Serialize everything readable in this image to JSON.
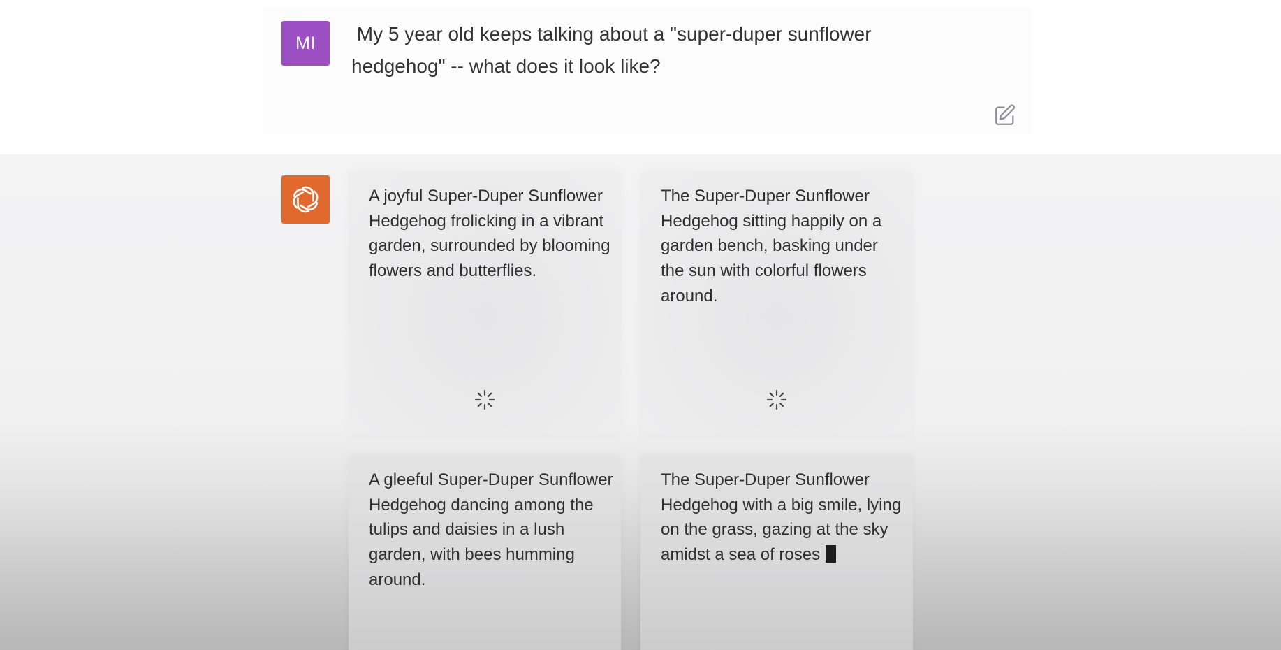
{
  "user_message": {
    "avatar_initials": "MI",
    "text": " My 5 year old keeps talking about a \"super-duper sunflower\nhedgehog\" -- what does it look like?"
  },
  "assistant_message": {
    "image_cards": [
      {
        "prompt": "A joyful Super-Duper Sunflower Hedgehog frolicking in a vibrant garden, surrounded by blooming flowers and butterflies.",
        "status": "loading"
      },
      {
        "prompt": "The Super-Duper Sunflower Hedgehog sitting happily on a garden bench, basking under the sun with colorful flowers around.",
        "status": "loading"
      },
      {
        "prompt": "A gleeful Super-Duper Sunflower Hedgehog dancing among the tulips and daisies in a lush garden, with bees humming around.",
        "status": "loading"
      },
      {
        "prompt": "The Super-Duper Sunflower Hedgehog with a big smile, lying on the grass, gazing at the sky amidst a sea of roses",
        "status": "streaming"
      }
    ]
  },
  "colors": {
    "user_avatar": "#9b4fc2",
    "assistant_avatar": "#e1692e"
  },
  "icons": {
    "edit": "edit-icon",
    "assistant_logo": "openai-logo-icon",
    "loading": "spinner-icon"
  }
}
